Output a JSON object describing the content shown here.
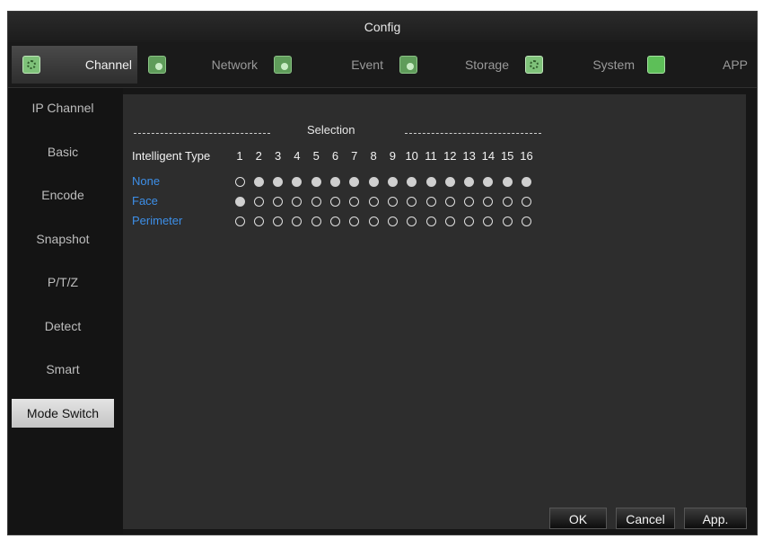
{
  "window": {
    "title": "Config"
  },
  "tabs": [
    {
      "label": "Channel",
      "icon": "channel-gear-icon",
      "active": true
    },
    {
      "label": "Network",
      "icon": "network-icon",
      "active": false
    },
    {
      "label": "Event",
      "icon": "event-icon",
      "active": false
    },
    {
      "label": "Storage",
      "icon": "storage-icon",
      "active": false
    },
    {
      "label": "System",
      "icon": "system-gear-icon",
      "active": false
    },
    {
      "label": "APP",
      "icon": "app-icon",
      "active": false
    }
  ],
  "sidebar": {
    "items": [
      {
        "label": "IP Channel",
        "active": false
      },
      {
        "label": "Basic",
        "active": false
      },
      {
        "label": "Encode",
        "active": false
      },
      {
        "label": "Snapshot",
        "active": false
      },
      {
        "label": "P/T/Z",
        "active": false
      },
      {
        "label": "Detect",
        "active": false
      },
      {
        "label": "Smart",
        "active": false
      },
      {
        "label": "Mode Switch",
        "active": true
      }
    ]
  },
  "panel": {
    "selection_title": "Selection",
    "type_header": "Intelligent Type",
    "channels": [
      "1",
      "2",
      "3",
      "4",
      "5",
      "6",
      "7",
      "8",
      "9",
      "10",
      "11",
      "12",
      "13",
      "14",
      "15",
      "16"
    ],
    "rows": [
      {
        "label": "None",
        "selected": [
          false,
          true,
          true,
          true,
          true,
          true,
          true,
          true,
          true,
          true,
          true,
          true,
          true,
          true,
          true,
          true
        ]
      },
      {
        "label": "Face",
        "selected": [
          true,
          false,
          false,
          false,
          false,
          false,
          false,
          false,
          false,
          false,
          false,
          false,
          false,
          false,
          false,
          false
        ]
      },
      {
        "label": "Perimeter",
        "selected": [
          false,
          false,
          false,
          false,
          false,
          false,
          false,
          false,
          false,
          false,
          false,
          false,
          false,
          false,
          false,
          false
        ]
      }
    ]
  },
  "buttons": {
    "ok": "OK",
    "cancel": "Cancel",
    "apply": "App."
  },
  "colors": {
    "accent_blue": "#3d8fe8",
    "background": "#161616",
    "panel": "#2d2d2d"
  }
}
